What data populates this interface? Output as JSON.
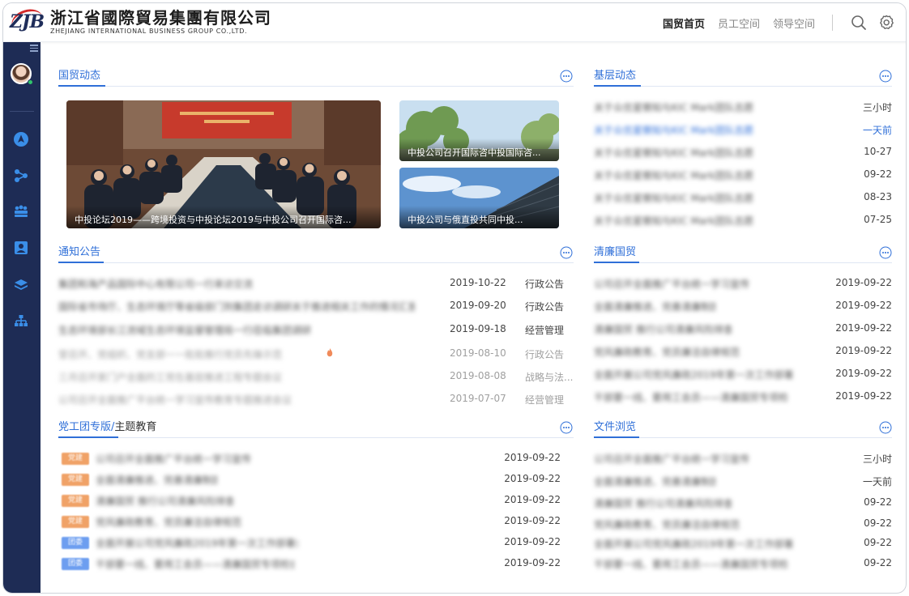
{
  "header": {
    "logo_mark": "ZJB",
    "logo_cn": "浙江省國際貿易集團有限公司",
    "logo_en": "ZHEJIANG INTERNATIONAL BUSINESS GROUP CO.,LTD.",
    "nav": [
      "国贸首页",
      "员工空间",
      "领导空间"
    ],
    "active_nav": "国贸首页",
    "search_icon": "search-icon",
    "settings_icon": "gear-icon"
  },
  "sidebar": {
    "icons": [
      "menu-collapse-icon",
      "avatar",
      "compass-icon",
      "share-icon",
      "team-icon",
      "profile-card-icon",
      "layers-icon",
      "org-chart-icon"
    ]
  },
  "news": {
    "title": "国贸动态",
    "main_caption": "中投论坛2019——跨境投资与中投论坛2019与中投公司召开国际咨...",
    "side_caption_1": "中投公司召开国际咨中投国际咨...",
    "side_caption_2": "中投公司与俄直投共同中投..."
  },
  "grassroots": {
    "title": "基层动态",
    "rows": [
      {
        "title": "关于众优星察知与KIC Mark团队志愿",
        "date": "三小时"
      },
      {
        "title": "关于众优星察知与KIC Mark团队志愿",
        "date": "一天前"
      },
      {
        "title": "关于众优星察知与KIC Mark团队志愿",
        "date": "10-27"
      },
      {
        "title": "关于众优星察知与KIC Mark团队志愿",
        "date": "09-22"
      },
      {
        "title": "关于众优星察知与KIC Mark团队志愿",
        "date": "08-23"
      },
      {
        "title": "关于众优星察知与KIC Mark团队志愿",
        "date": "07-25"
      }
    ]
  },
  "notices": {
    "title": "通知公告",
    "rows": [
      {
        "title": "集团和海产品国际中心有限公司一行来访交流",
        "date": "2019-10-22",
        "category": "行政公告"
      },
      {
        "title": "国际省市场厅、生态环境厅等省级部门到集团走访调研关于推进相关工作的情况汇报",
        "date": "2019-09-20",
        "category": "行政公告"
      },
      {
        "title": "生态环境部长江流域生态环境监督管理局一行莅临集团调研",
        "date": "2019-09-18",
        "category": "经营管理"
      },
      {
        "title": "堂召开、党组织、党支部一一批批推行党员先锋示范",
        "date": "2019-08-10",
        "category": "行政公告"
      },
      {
        "title": "三月召开家门户全面的工党在基层推进工程专题会议",
        "date": "2019-08-08",
        "category": "战略与法..."
      },
      {
        "title": "公司召开全面推广平台统一学习宣传教育专题推进会议",
        "date": "2019-07-07",
        "category": "经营管理"
      }
    ]
  },
  "integrity": {
    "title": "清廉国贸",
    "rows": [
      {
        "title": "公司召开全面推广平台统一学习宣传",
        "date": "2019-09-22"
      },
      {
        "title": "全面清廉推进、完善清廉制度",
        "date": "2019-09-22"
      },
      {
        "title": "清廉国贸 推行公司清廉风险排查",
        "date": "2019-09-22"
      },
      {
        "title": "党风廉政教育、党员廉洁自律规范",
        "date": "2019-09-22"
      },
      {
        "title": "全面开展公司党风廉政2019年第一次工作部署会",
        "date": "2019-09-22"
      },
      {
        "title": "干部要一线、要用工会员——清廉国贸专项检查",
        "date": "2019-09-22"
      }
    ]
  },
  "party": {
    "title_part1": "党工团专版/",
    "title_part2": "主题教育",
    "rows": [
      {
        "tag": "党建",
        "tag_color": "#f0a267",
        "title": "公司召开全面推广平台统一学习宣传",
        "date": "2019-09-22"
      },
      {
        "tag": "党建",
        "tag_color": "#f0a267",
        "title": "全面清廉推进、完善清廉制度",
        "date": "2019-09-22"
      },
      {
        "tag": "党建",
        "tag_color": "#f0a267",
        "title": "清廉国贸 推行公司清廉风险排查",
        "date": "2019-09-22"
      },
      {
        "tag": "党建",
        "tag_color": "#f0a267",
        "title": "党风廉政教育、党员廉洁自律规范",
        "date": "2019-09-22"
      },
      {
        "tag": "团委",
        "tag_color": "#6d9ef0",
        "title": "全面开展公司党风廉政2019年第一次工作部署会",
        "date": "2019-09-22"
      },
      {
        "tag": "团委",
        "tag_color": "#6d9ef0",
        "title": "干部要一线、要用工会员——清廉国贸专项检查",
        "date": "2019-09-22"
      }
    ]
  },
  "files": {
    "title": "文件浏览",
    "rows": [
      {
        "title": "公司召开全面推广平台统一学习宣传",
        "date": "三小时"
      },
      {
        "title": "全面清廉推进、完善清廉制度",
        "date": "一天前"
      },
      {
        "title": "清廉国贸 推行公司清廉风险排查",
        "date": "09-22"
      },
      {
        "title": "党风廉政教育、党员廉洁自律规范",
        "date": "09-22"
      },
      {
        "title": "全面开展公司党风廉政2019年第一次工作部署会",
        "date": "09-22"
      },
      {
        "title": "干部要一线、要用工会员——清廉国贸专项检查",
        "date": "09-22"
      }
    ]
  },
  "colors": {
    "accent": "#2f6fd8",
    "sidebar": "#1e2c55",
    "logo_red": "#d42a2a"
  }
}
